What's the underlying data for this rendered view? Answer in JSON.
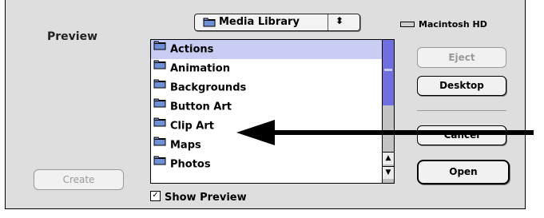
{
  "preview_label": "Preview",
  "location_popup": {
    "label": "Media Library",
    "arrows": "⬍"
  },
  "drive": {
    "label": "Macintosh HD"
  },
  "file_list": {
    "items": [
      {
        "label": "Actions",
        "selected": true
      },
      {
        "label": "Animation"
      },
      {
        "label": "Backgrounds"
      },
      {
        "label": "Button Art"
      },
      {
        "label": "Clip Art"
      },
      {
        "label": "Maps"
      },
      {
        "label": "Photos"
      }
    ]
  },
  "scrollbar": {
    "up_arrow": "▲",
    "down_arrow": "▼"
  },
  "buttons": {
    "eject": "Eject",
    "desktop": "Desktop",
    "cancel": "Cancel",
    "open": "Open",
    "create": "Create"
  },
  "show_preview": {
    "label": "Show Preview",
    "checked": true,
    "check_mark": "✓"
  },
  "icons": {
    "folder": "folder-icon",
    "drive": "hard-drive-icon",
    "callout": "arrow-left-icon"
  },
  "colors": {
    "dialog_bg": "#dedede",
    "selection": "#c9ccf3",
    "scroll_accent": "#6f6fe0",
    "folder": "#6d8fd6"
  }
}
